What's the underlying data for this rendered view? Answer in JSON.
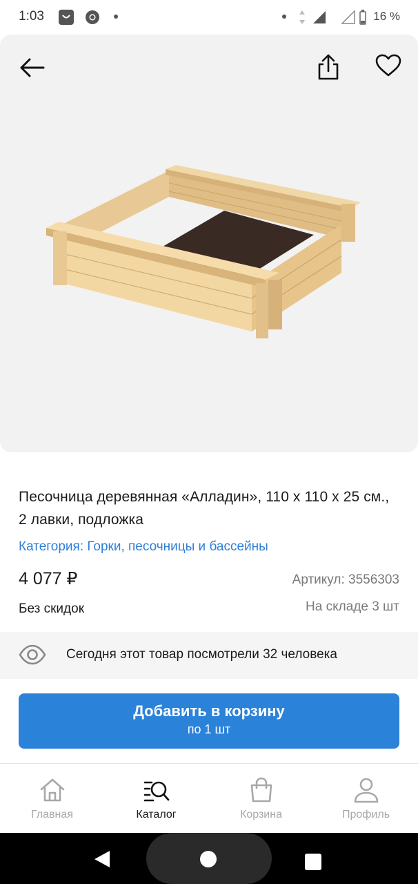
{
  "status_bar": {
    "time": "1:03",
    "battery": "16 %"
  },
  "product": {
    "title": "Песочница деревянная «Алладин», 110 х 110 х 25 см., 2 лавки, подложка",
    "category": "Категория: Горки, песочницы и бассейны",
    "price": "4 077 ₽",
    "sku": "Артикул: 3556303",
    "discount": "Без скидок",
    "stock": "На складе 3 шт",
    "viewers": "Сегодня этот товар посмотрели 32 человека"
  },
  "cart_button": {
    "label": "Добавить в корзину",
    "sub_label": "по 1 шт"
  },
  "tabs": [
    {
      "label": "Главная",
      "icon": "home-icon"
    },
    {
      "label": "Каталог",
      "icon": "catalog-search-icon"
    },
    {
      "label": "Корзина",
      "icon": "bag-icon"
    },
    {
      "label": "Профиль",
      "icon": "user-icon"
    }
  ],
  "colors": {
    "accent": "#2b82d9",
    "category_link": "#2d7fd8",
    "hero_bg": "#f2f2f2"
  }
}
